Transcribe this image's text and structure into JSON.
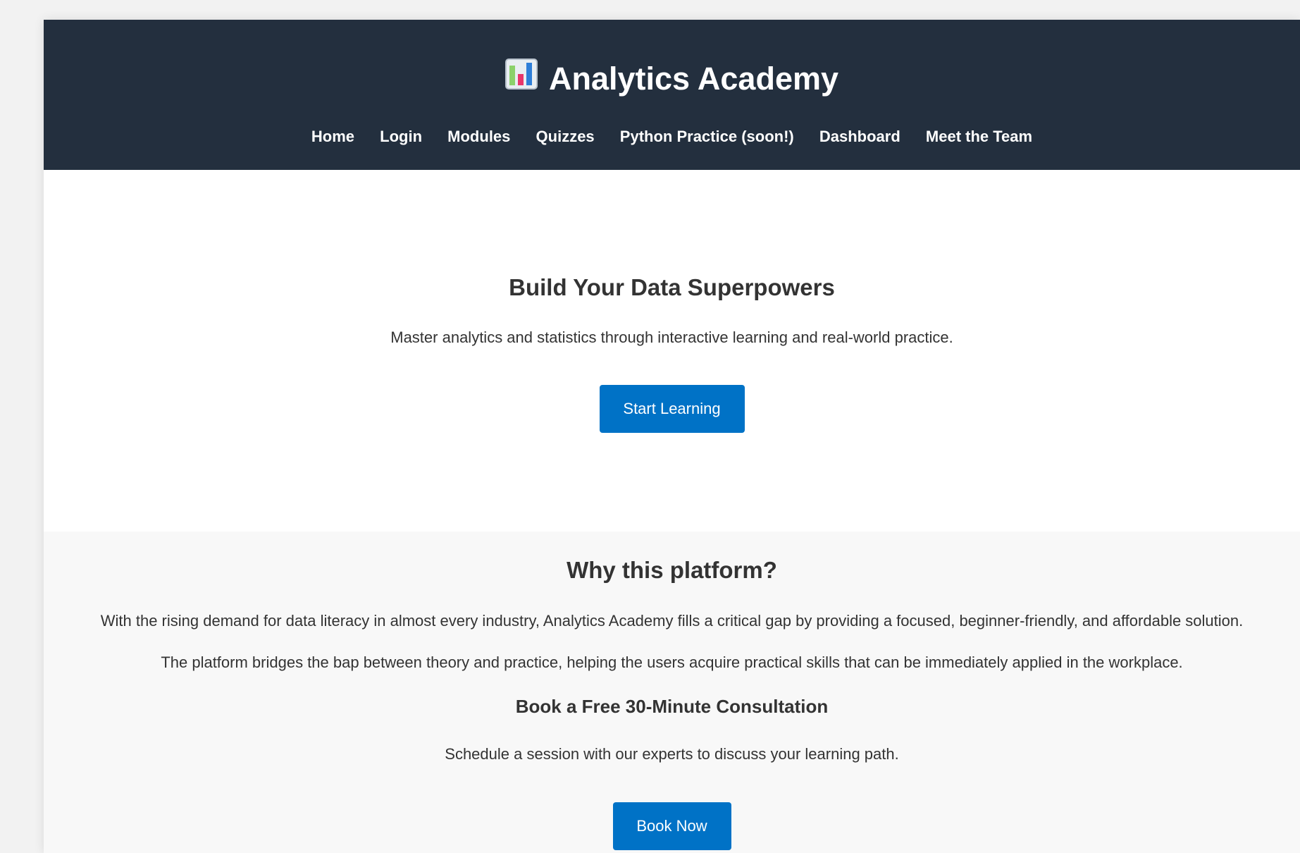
{
  "header": {
    "brand_title": "Analytics Academy",
    "brand_icon": "bar-chart-icon"
  },
  "nav": {
    "items": [
      {
        "label": "Home"
      },
      {
        "label": "Login"
      },
      {
        "label": "Modules"
      },
      {
        "label": "Quizzes"
      },
      {
        "label": "Python Practice (soon!)"
      },
      {
        "label": "Dashboard"
      },
      {
        "label": "Meet the Team"
      }
    ]
  },
  "hero": {
    "title": "Build Your Data Superpowers",
    "subtitle": "Master analytics and statistics through interactive learning and real-world practice.",
    "cta_label": "Start Learning"
  },
  "why": {
    "title": "Why this platform?",
    "paragraph_1": "With the rising demand for data literacy in almost every industry, Analytics Academy fills a critical gap by providing a focused, beginner-friendly, and affordable solution.",
    "paragraph_2": "The platform bridges the bap between theory and practice, helping the users acquire practical skills that can be immediately applied in the workplace."
  },
  "consultation": {
    "title": "Book a Free 30-Minute Consultation",
    "text": "Schedule a session with our experts to discuss your learning path.",
    "cta_label": "Book Now"
  },
  "colors": {
    "header_bg": "#232f3e",
    "button_bg": "#0072c6",
    "section_bg": "#f8f8f8"
  }
}
